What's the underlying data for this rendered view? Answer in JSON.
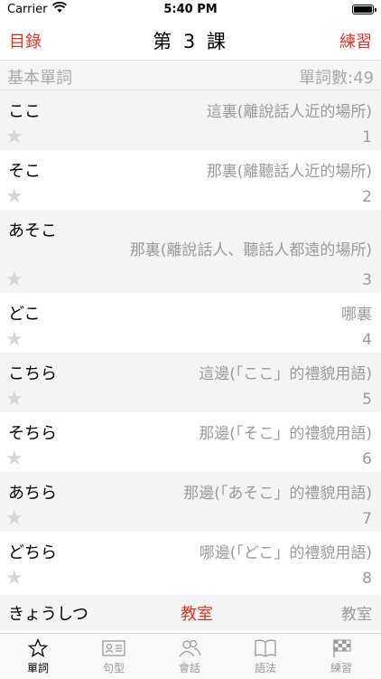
{
  "status": {
    "carrier": "Carrier",
    "time": "5:40 PM"
  },
  "nav": {
    "left": "目錄",
    "title": "第 3 課",
    "right": "練習"
  },
  "section": {
    "left": "基本單詞",
    "right": "單詞數:49"
  },
  "rows": [
    {
      "jp": "ここ",
      "meaning": "這裏(離說話人近的場所)",
      "num": "1"
    },
    {
      "jp": "そこ",
      "meaning": "那裏(離聽話人近的場所)",
      "num": "2"
    },
    {
      "jp": "あそこ",
      "meaning": "那裏(離說話人、聽話人都遠的場所)",
      "num": "3"
    },
    {
      "jp": "どこ",
      "meaning": "哪裏",
      "num": "4"
    },
    {
      "jp": "こちら",
      "meaning": "這邊(「ここ」的禮貌用語)",
      "num": "5"
    },
    {
      "jp": "そちら",
      "meaning": "那邊(「そこ」的禮貌用語)",
      "num": "6"
    },
    {
      "jp": "あちら",
      "meaning": "那邊(「あそこ」的禮貌用語)",
      "num": "7"
    },
    {
      "jp": "どちら",
      "meaning": "哪邊(「どこ」的禮貌用語)",
      "num": "8"
    }
  ],
  "partial": {
    "jp": "きょうしつ",
    "kanji": "教室",
    "meaning": "教室"
  },
  "tabs": [
    {
      "label": "單詞",
      "icon": "star-icon",
      "active": true
    },
    {
      "label": "句型",
      "icon": "id-card-icon",
      "active": false
    },
    {
      "label": "會話",
      "icon": "people-icon",
      "active": false
    },
    {
      "label": "語法",
      "icon": "book-icon",
      "active": false
    },
    {
      "label": "練習",
      "icon": "checkered-flag-icon",
      "active": false
    }
  ],
  "colors": {
    "accent": "#d9362b",
    "secondary_text": "#9a9a9a",
    "star": "#d6d6d6",
    "row_alt": "#f4f4f4"
  }
}
